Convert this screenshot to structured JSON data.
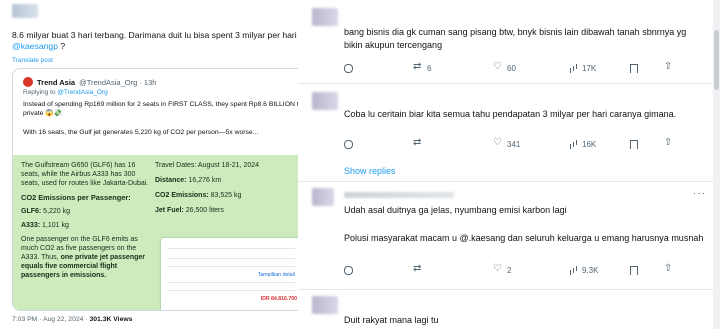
{
  "left": {
    "tweet_text_1": "8.6 milyar buat 3 hari terbang. Darimana duit lu bisa spent 3 milyar per hari bro ",
    "tweet_mention": "@kaesangp",
    "tweet_text_2": " ?",
    "translate": "Translate post",
    "quote": {
      "name": "Trend Asia",
      "handle": "@TrendAsia_Org · 13h",
      "replying_prefix": "Replying to ",
      "replying_mention": "@TrendAsia_Org",
      "body_1": "Instead of spending Rp169 million for 2 seats in FIRST CLASS, they spent Rp8.6 BILLION to fly private 😱💸",
      "body_2": "With 16 seats, the Gulf jet generates 5,220 kg of CO2 per person—5x worse...",
      "infographic": {
        "p1": "The Gulfstream G650 (GLF6) has 16 seats, while the Airbus A333 has 300 seats, used for routes like Jakarta-Dubai.",
        "h": "CO2 Emissions per Passenger:",
        "glf6_label": "GLF6:",
        "glf6_value": " 5,220 kg",
        "a333_label": "A333:",
        "a333_value": " 1,101 kg",
        "p3a": "One passenger on the GLF6 emits as much CO2 as five passengers on the A333. Thus, ",
        "p3b": "one private jet passenger equals five commercial flight passengers in emissions.",
        "travel_dates": "Travel Dates: August 18-21, 2024",
        "distance_label": "Distance:",
        "distance_value": " 16,276 km",
        "co2_label": "CO2 Emissions:",
        "co2_value": " 83,525 kg",
        "fuel_label": "Jet Fuel:",
        "fuel_value": " 26,500 liters",
        "ticket_price": "IDR 84.816.700",
        "ticket_link": "Tampilkan detail"
      }
    },
    "meta_time": "7:03 PM · Aug 22, 2024 · ",
    "meta_views": "301.3K Views"
  },
  "comments": [
    {
      "text": "bang bisnis dia gk cuman sang pisang btw, bnyk bisnis lain dibawah tanah sbnrnya yg bikin akupun tercengang",
      "retweets": "6",
      "likes": "60",
      "views": "17K"
    },
    {
      "text": "Coba lu ceritain biar kita semua tahu pendapatan 3 milyar per hari caranya gimana.",
      "retweets": "",
      "likes": "341",
      "views": "16K",
      "replies_count": "",
      "show_replies": "Show replies"
    },
    {
      "text_1": "Udah asal duitnya ga jelas, nyumbang emisi karbon lagi",
      "text_2": "Polusi masyarakat macam u @.kaesang dan seluruh keluarga u emang harusnya musnah",
      "retweets": "",
      "likes": "2",
      "views": "9.3K"
    },
    {
      "text": "Duit rakyat mana lagi tu"
    }
  ]
}
